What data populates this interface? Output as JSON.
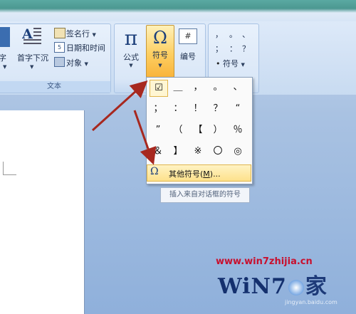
{
  "ribbon": {
    "textgroup": {
      "label": "文本",
      "partial_btn": "字",
      "dropcap_btn": "首字下沉",
      "signature_line": "签名行",
      "date_time": "日期和时间",
      "object": "对象"
    },
    "equation": {
      "label": "公式",
      "icon": "π"
    },
    "symbol": {
      "label": "符号",
      "icon": "Ω"
    },
    "numbering": {
      "label": "编号",
      "icon": "#"
    },
    "special_symbols": {
      "grid": [
        "，",
        "。",
        "、",
        "；",
        "：",
        "？"
      ],
      "label": "符号"
    }
  },
  "dropdown": {
    "symbols": [
      "☑",
      "＿",
      "，",
      "。",
      "、",
      "；",
      "：",
      "！",
      "？",
      "“",
      "”",
      "（",
      "【",
      "）",
      "％",
      "＆",
      "】",
      "※",
      "〇",
      "◎"
    ],
    "more_label": "其他符号(",
    "more_key": "M",
    "more_suffix": ")...",
    "more_icon": "Ω"
  },
  "tooltip": "插入来自对话框的符号",
  "watermark": {
    "url": "www.win7zhijia.cn",
    "logo_text": "WiN7",
    "logo_suffix": "家",
    "sub": "jingyan.baidu.com"
  },
  "colors": {
    "accent_red": "#c8102e",
    "arrow": "#a7281f",
    "highlight": "#fde18b"
  }
}
